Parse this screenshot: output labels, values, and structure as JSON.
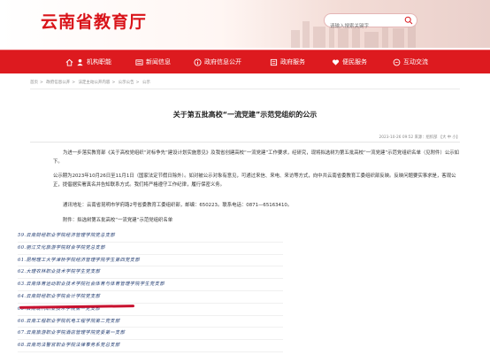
{
  "header": {
    "site_title": "云南省教育厅",
    "search_placeholder": "请输入搜索关键字"
  },
  "nav": [
    {
      "label": "首页",
      "icon": "home-icon"
    },
    {
      "label": "机构职能",
      "icon": "people-icon"
    },
    {
      "label": "新闻信息",
      "icon": "news-icon"
    },
    {
      "label": "政府信息公开",
      "icon": "info-icon"
    },
    {
      "label": "政府服务",
      "icon": "service-icon"
    },
    {
      "label": "便民服务",
      "icon": "heart-icon"
    },
    {
      "label": "互动交流",
      "icon": "chat-icon"
    }
  ],
  "breadcrumb": [
    "首页",
    "政府信息公开",
    "法定主动公开内容",
    "公示公告",
    "公示"
  ],
  "article": {
    "title": "关于第五批高校“一流党建”示范党组织的公示",
    "meta": "2023-10-26 09:52 来源：组织部 【大 中 小】",
    "paragraphs": [
      "为进一步落实教育部《关于高校党组织“对标争先”建设计划实施意见》及我省创建高校“一流党建”工作要求，经研究，现将拟选树为第五批高校“一流党建”示范党组织名单（见附件）公示如下。",
      "公示期为2023年10月26日至11月1日（国家法定节假日除外）。如对被公示对象有意见，可通过来信、来电、来访等方式，向中共云南省委教育工委组织部反映。反映问题要实事求是，客观公正，提倡据实署真名并告知联系方式。我们将严格遵守工作纪律，履行保密义务。",
      "通讯地址：云南省昆明市学府路2号省委教育工委组织部，邮编：650223。联系电话：0871—65163410。",
      "附件：拟选树第五批高校“一流党建”示范党组织名单"
    ]
  },
  "list": [
    "59.云南财经职业学院经济管理学院党总支部",
    "60.丽江文化旅游学院财会学院党总支部",
    "61.昆明理工大学津桥学院经济管理学院学生第四党支部",
    "62.大理农林职业技术学院学生党支部",
    "63.云南体育运动职业技术学院社会体育与体育管理学院学生党支部",
    "64.云南财经职业学院会计学院党支部",
    "65.云南现代职业技术学院第一党支部",
    "66.云南工程职业学院机电工程学院第二党支部",
    "67.云南旅游职业学院酒店管理学院党委第一支部",
    "68.云南司法警官职业学院法律事务系党总支部"
  ],
  "colors": {
    "brand_red": "#d9141a",
    "nav_red": "#dd1a1f",
    "annotation_red": "#c8102e"
  }
}
